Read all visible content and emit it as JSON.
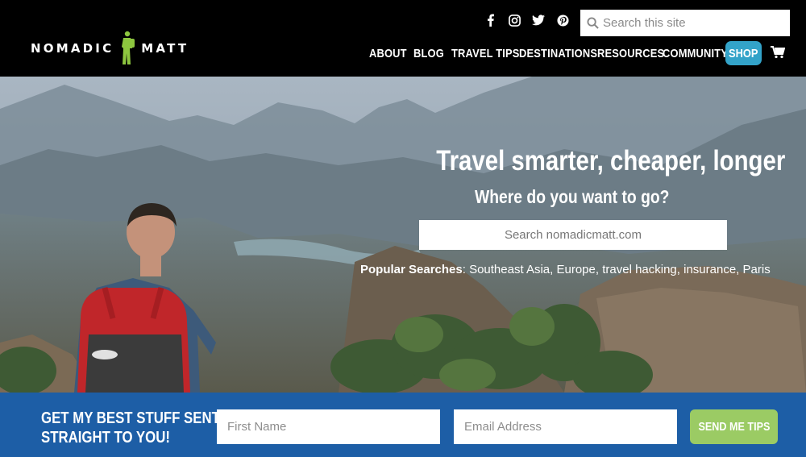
{
  "brand": {
    "name_left": "NOMADIC",
    "name_right": "MATT",
    "figure_icon": "hiker-silhouette-icon",
    "figure_color": "#8dc63f"
  },
  "social": [
    {
      "name": "facebook-icon",
      "glyph": "f"
    },
    {
      "name": "instagram-icon",
      "glyph": "◎"
    },
    {
      "name": "twitter-icon",
      "glyph": "🐦"
    },
    {
      "name": "pinterest-icon",
      "glyph": "P"
    }
  ],
  "site_search": {
    "placeholder": "Search this site",
    "icon": "search-icon"
  },
  "nav": {
    "items": [
      "ABOUT",
      "BLOG",
      "TRAVEL TIPS",
      "DESTINATIONS",
      "RESOURCES",
      "COMMUNITY"
    ],
    "shop_label": "SHOP",
    "cart_icon": "shopping-cart-icon",
    "shop_color": "#33a3c9"
  },
  "hero": {
    "headline": "Travel smarter, cheaper, longer",
    "subhead": "Where do you want to go?",
    "search_placeholder": "Search nomadicmatt.com",
    "popular_label": "Popular Searches",
    "popular_separator": ":",
    "popular_items": [
      "Southeast Asia",
      "Europe",
      "travel hacking",
      "insurance",
      "Paris"
    ]
  },
  "signup": {
    "title_line1": "GET MY BEST STUFF SENT",
    "title_line2": "STRAIGHT TO YOU!",
    "first_name_placeholder": "First Name",
    "email_placeholder": "Email Address",
    "button_label": "SEND ME TIPS",
    "bar_color": "#1d5ea6",
    "button_color": "#9bcb64"
  }
}
